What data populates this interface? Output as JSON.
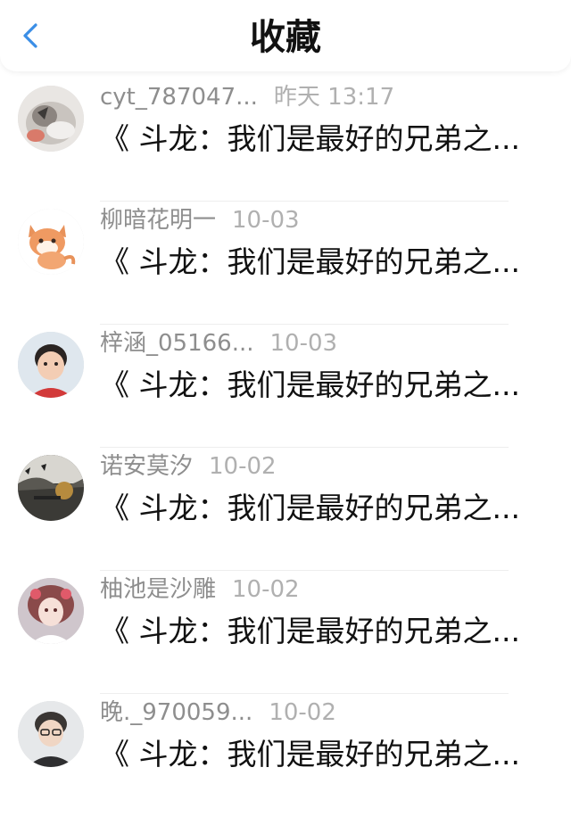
{
  "header": {
    "title": "收藏",
    "back_icon": "chevron-left-icon",
    "accent_color": "#3a8ee6"
  },
  "items": [
    {
      "name": "cyt_787047...",
      "time": "昨天 13:17",
      "content": "《 斗龙：我们是最好的兄弟之..."
    },
    {
      "name": "柳暗花明一",
      "time": "10-03",
      "content": "《 斗龙：我们是最好的兄弟之..."
    },
    {
      "name": "梓涵_05166...",
      "time": "10-03",
      "content": "《 斗龙：我们是最好的兄弟之..."
    },
    {
      "name": "诺安莫汐",
      "time": "10-02",
      "content": "《 斗龙：我们是最好的兄弟之..."
    },
    {
      "name": "柚池是沙雕",
      "time": "10-02",
      "content": "《 斗龙：我们是最好的兄弟之..."
    },
    {
      "name": "晚._970059...",
      "time": "10-02",
      "content": "《 斗龙：我们是最好的兄弟之..."
    }
  ]
}
